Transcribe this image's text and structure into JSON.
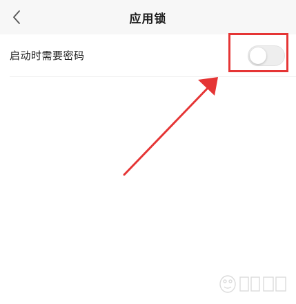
{
  "navbar": {
    "title": "应用锁",
    "back_icon": "chevron-left-icon"
  },
  "settings": {
    "items": [
      {
        "label": "启动时需要密码",
        "toggle_state": "off"
      }
    ]
  },
  "annotation": {
    "highlight_color": "#e53535",
    "arrow_color": "#e53535"
  },
  "colors": {
    "navbar_bg": "#f7f7f7",
    "toggle_off_bg": "#eeeeee",
    "text": "#222222"
  }
}
